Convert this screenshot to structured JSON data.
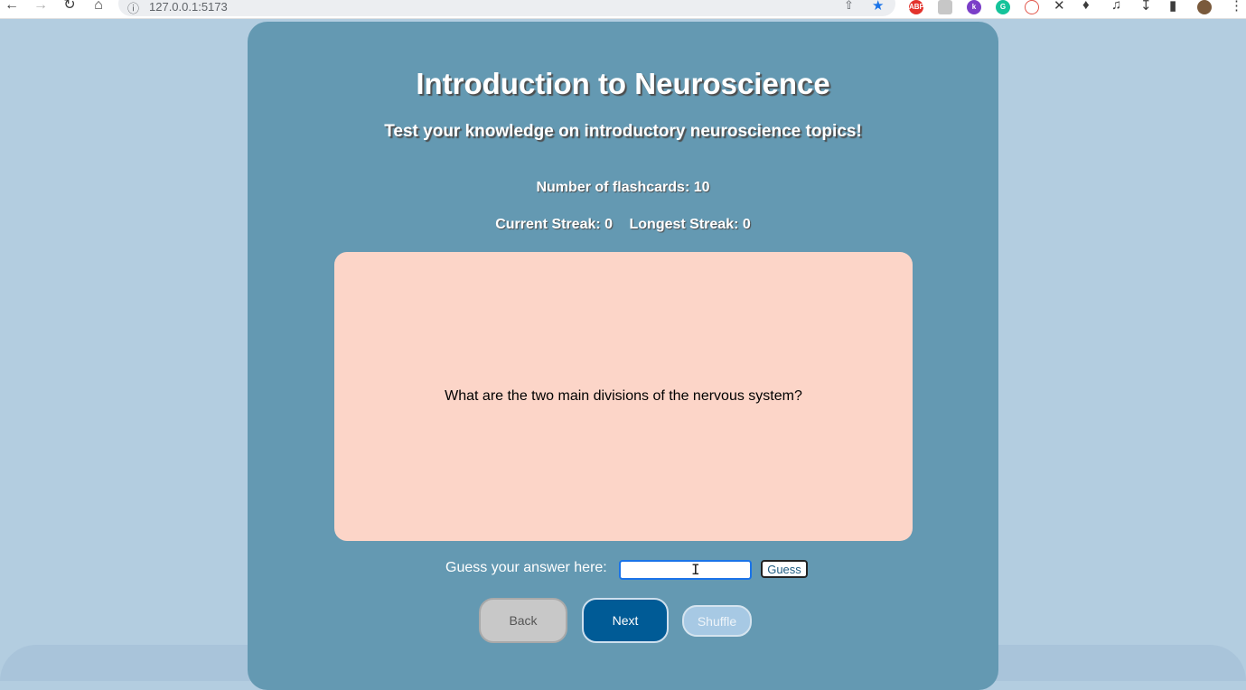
{
  "browser": {
    "url": "127.0.0.1:5173",
    "icons": [
      "back-arrow-icon",
      "forward-arrow-icon",
      "reload-icon",
      "home-icon",
      "info-icon",
      "share-icon",
      "bookmark-star-icon",
      "extensions-icon",
      "media-icon",
      "download-icon",
      "sidebar-icon",
      "profile-avatar",
      "menu-icon"
    ],
    "extensions": [
      {
        "name": "adblock-plus",
        "label": "ABP",
        "color": "#e3332c"
      },
      {
        "name": "grey-ext",
        "label": "",
        "color": "#c7c7c7"
      },
      {
        "name": "k-ext",
        "label": "k",
        "color": "#7b3fc8"
      },
      {
        "name": "grammarly",
        "label": "G",
        "color": "#15c39a"
      },
      {
        "name": "red-ext",
        "label": "",
        "color": "#e2574c"
      },
      {
        "name": "x-ext",
        "label": "X",
        "color": "#3c3c3c"
      }
    ]
  },
  "app": {
    "title": "Introduction to Neuroscience",
    "subtitle": "Test your knowledge on introductory neuroscience topics!",
    "count_text": "Number of flashcards: 10",
    "current_streak": "Current Streak: 0",
    "longest_streak": "Longest Streak: 0",
    "card_question": "What are the two main divisions of the nervous system?",
    "guess_label": "Guess your answer here:",
    "guess_value": "",
    "guess_button": "Guess",
    "back_button": "Back",
    "next_button": "Next",
    "shuffle_button": "Shuffle"
  },
  "colors": {
    "page_bg": "#b3cde0",
    "panel_bg": "#6499b2",
    "card_bg": "#fcd5c8",
    "next_bg": "#005b96",
    "back_bg": "#c8c8c8",
    "shuffle_bg": "#a7c9e4"
  }
}
